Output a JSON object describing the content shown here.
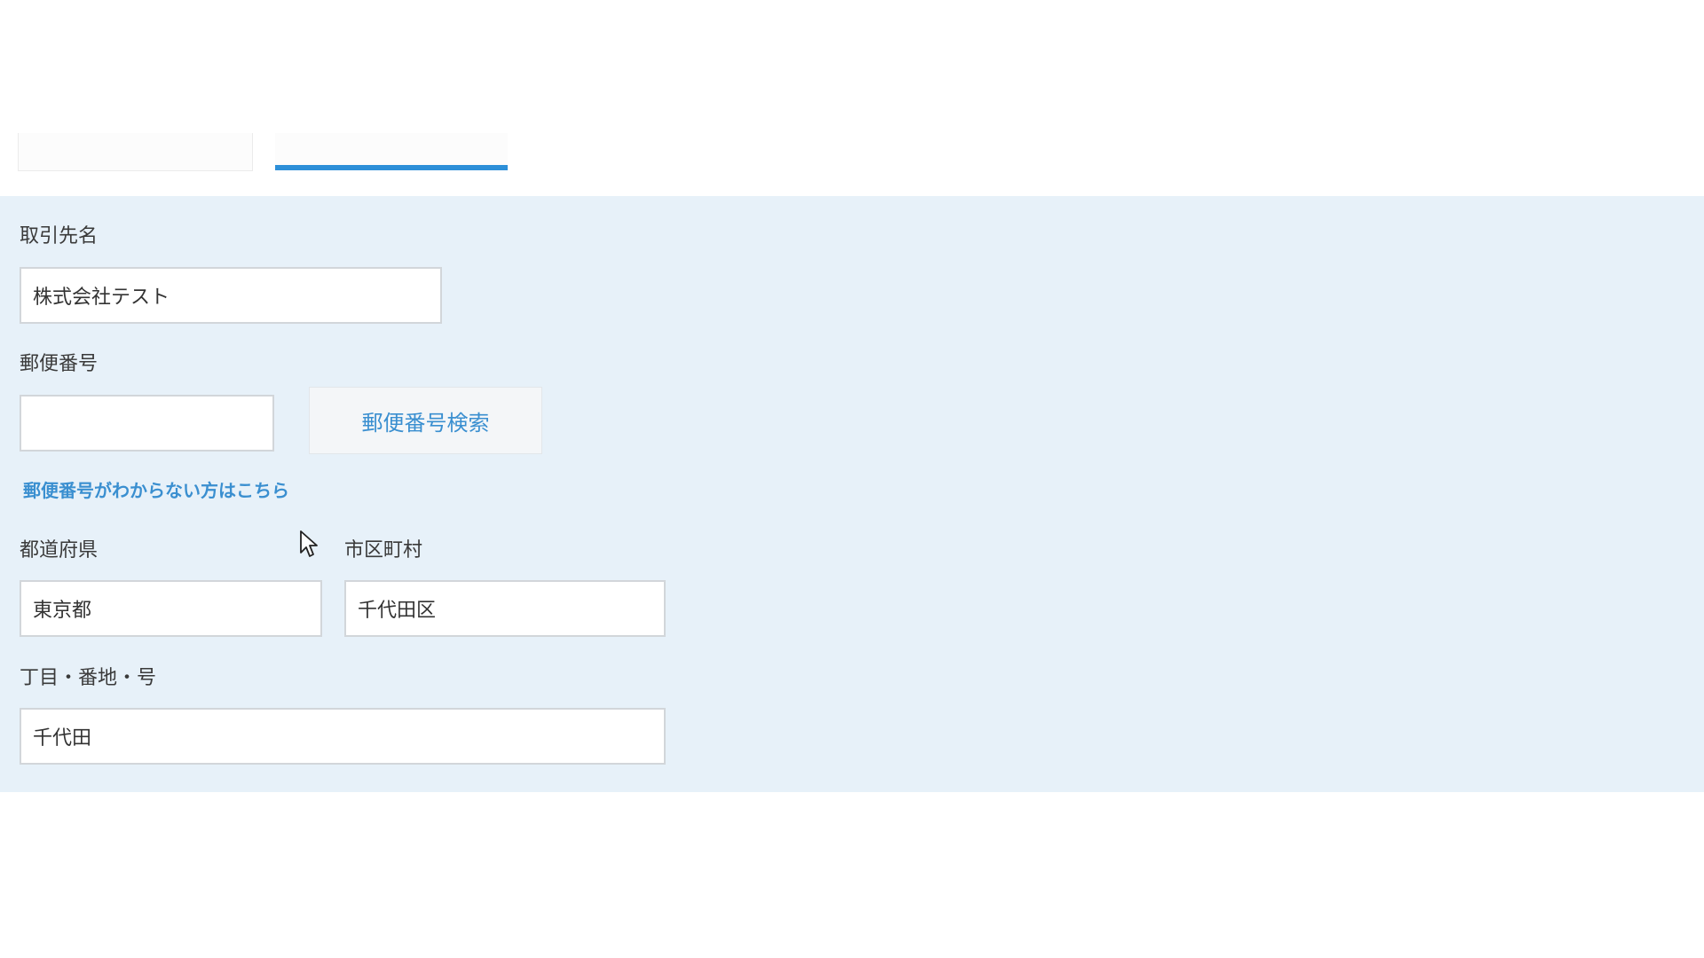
{
  "form": {
    "client_name": {
      "label": "取引先名",
      "value": "株式会社テスト"
    },
    "postal_code": {
      "label": "郵便番号",
      "value": "",
      "search_button": "郵便番号検索",
      "help_link": "郵便番号がわからない方はこちら"
    },
    "prefecture": {
      "label": "都道府県",
      "value": "東京都"
    },
    "city": {
      "label": "市区町村",
      "value": "千代田区"
    },
    "address_line": {
      "label": "丁目・番地・号",
      "value": "千代田"
    }
  },
  "icons": {
    "cursor": "mouse-pointer-icon"
  },
  "colors": {
    "accent": "#2d8fd8",
    "panel_bg": "#e7f1f9",
    "link": "#3a8fd0"
  }
}
